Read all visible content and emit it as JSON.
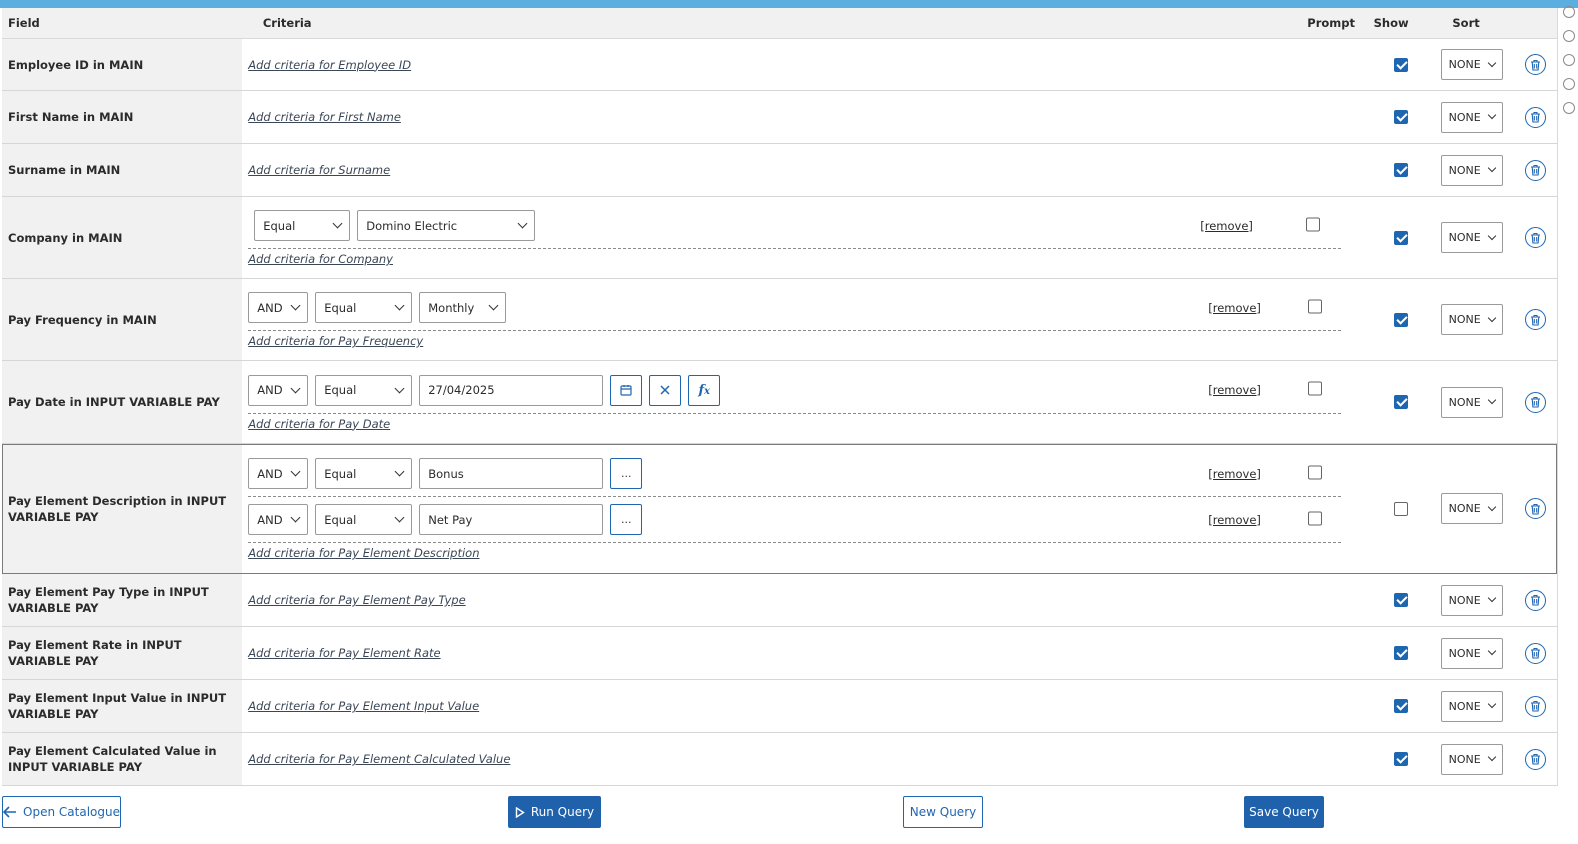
{
  "header": {
    "field": "Field",
    "criteria": "Criteria",
    "prompt": "Prompt",
    "show": "Show",
    "sort": "Sort"
  },
  "remove_label": "[remove]",
  "rows": [
    {
      "field": "Employee ID in MAIN",
      "add_label": "Add criteria for Employee ID",
      "show": true,
      "sort": "NONE"
    },
    {
      "field": "First Name in MAIN",
      "add_label": "Add criteria for First Name",
      "show": true,
      "sort": "NONE"
    },
    {
      "field": "Surname in MAIN",
      "add_label": "Add criteria for Surname",
      "show": true,
      "sort": "NONE"
    },
    {
      "field": "Company in MAIN",
      "add_label": "Add criteria for Company",
      "show": true,
      "sort": "NONE",
      "criteria": [
        {
          "operator": "Equal",
          "value": "Domino Electric",
          "prompt": false
        }
      ]
    },
    {
      "field": "Pay Frequency in MAIN",
      "add_label": "Add criteria for Pay Frequency",
      "show": true,
      "sort": "NONE",
      "criteria": [
        {
          "conjunction": "AND",
          "operator": "Equal",
          "value": "Monthly",
          "prompt": false
        }
      ]
    },
    {
      "field": "Pay Date in INPUT VARIABLE PAY",
      "add_label": "Add criteria for Pay Date",
      "show": true,
      "sort": "NONE",
      "criteria": [
        {
          "conjunction": "AND",
          "operator": "Equal",
          "value": "27/04/2025",
          "prompt": false
        }
      ]
    },
    {
      "field": "Pay Element Description in INPUT VARIABLE PAY",
      "add_label": "Add criteria for Pay Element Description",
      "show": false,
      "sort": "NONE",
      "criteria": [
        {
          "conjunction": "AND",
          "operator": "Equal",
          "value": "Bonus",
          "prompt": false
        },
        {
          "conjunction": "AND",
          "operator": "Equal",
          "value": "Net Pay",
          "prompt": false
        }
      ]
    },
    {
      "field": "Pay Element Pay Type in INPUT VARIABLE PAY",
      "add_label": "Add criteria for Pay Element Pay Type",
      "show": true,
      "sort": "NONE"
    },
    {
      "field": "Pay Element Rate in INPUT VARIABLE PAY",
      "add_label": "Add criteria for Pay Element Rate",
      "show": true,
      "sort": "NONE"
    },
    {
      "field": "Pay Element Input Value in INPUT VARIABLE PAY",
      "add_label": "Add criteria for Pay Element Input Value",
      "show": true,
      "sort": "NONE"
    },
    {
      "field": "Pay Element Calculated Value in INPUT VARIABLE PAY",
      "add_label": "Add criteria for Pay Element Calculated Value",
      "show": true,
      "sort": "NONE"
    }
  ],
  "footer": {
    "open_catalogue": "Open Catalogue",
    "run_query": "Run Query",
    "new_query": "New Query",
    "save_query": "Save Query"
  },
  "ellipsis": "...",
  "icons": {
    "calendar": "calendar-icon",
    "clear": "close-icon",
    "formula": "function-icon",
    "delete": "trash-icon",
    "back": "arrow-left-icon",
    "play": "play-icon"
  },
  "colors": {
    "accent": "#1f66b0",
    "topbar": "#5aaee0",
    "field_bg": "#f1f1f1"
  }
}
